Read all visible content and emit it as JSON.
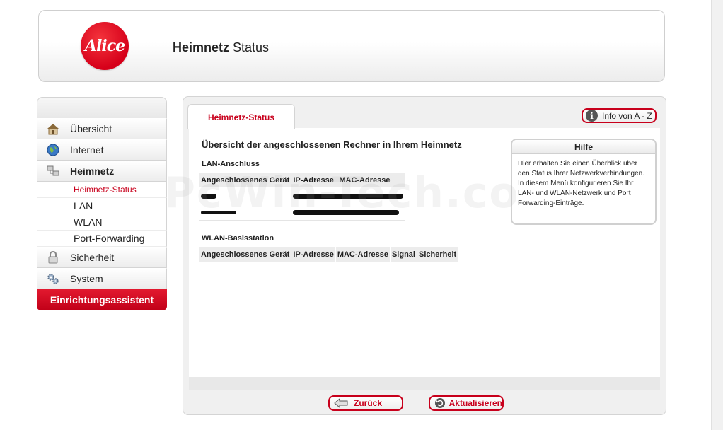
{
  "header": {
    "logo_text": "Alice",
    "title_bold": "Heimnetz",
    "title_rest": "Status"
  },
  "nav": {
    "items": [
      {
        "label": "Übersicht",
        "icon": "home-icon"
      },
      {
        "label": "Internet",
        "icon": "globe-icon"
      },
      {
        "label": "Heimnetz",
        "icon": "network-icon",
        "active": true
      },
      {
        "label": "Sicherheit",
        "icon": "lock-icon"
      },
      {
        "label": "System",
        "icon": "gears-icon"
      }
    ],
    "subitems": [
      {
        "label": "Heimnetz-Status",
        "active": true
      },
      {
        "label": "LAN"
      },
      {
        "label": "WLAN"
      },
      {
        "label": "Port-Forwarding"
      }
    ],
    "assistant_label": "Einrichtungsassistent"
  },
  "main": {
    "tab_label": "Heimnetz-Status",
    "info_button": "Info von A - Z",
    "heading": "Übersicht der angeschlossenen Rechner in Ihrem Heimnetz",
    "lan": {
      "label": "LAN-Anschluss",
      "columns": [
        "Angeschlossenes Gerät",
        "IP-Adresse",
        "MAC-Adresse"
      ]
    },
    "wlan": {
      "label": "WLAN-Basisstation",
      "columns": [
        "Angeschlossenes Gerät",
        "IP-Adresse",
        "MAC-Adresse",
        "Signal",
        "Sicherheit"
      ]
    },
    "help": {
      "title": "Hilfe",
      "text": "Hier erhalten Sie einen Überblick über den Status Ihrer Netzwerkverbindungen. In diesem Menü konfigurieren Sie Ihr LAN- und WLAN-Netzwerk und Port Forwarding-Einträge."
    },
    "watermark": "PcWin-Tech.co",
    "buttons": {
      "back": "Zurück",
      "refresh": "Aktualisieren"
    }
  },
  "colors": {
    "brand_red": "#c8001c",
    "border_gray": "#d4d4d4"
  }
}
